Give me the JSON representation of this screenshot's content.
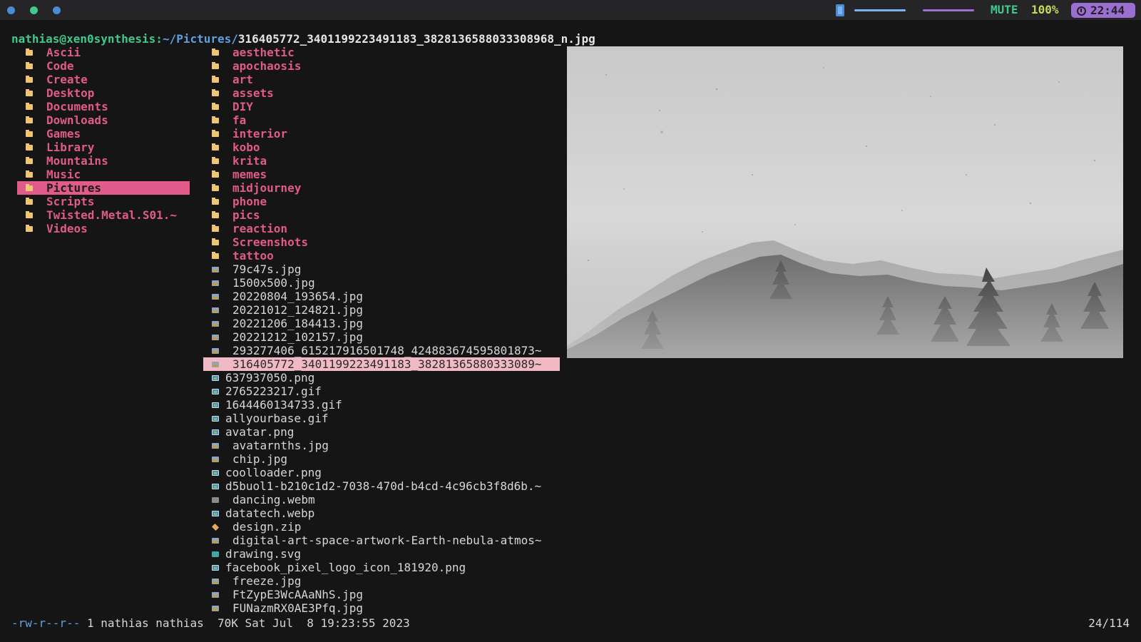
{
  "topbar": {
    "workspaces": [
      {
        "name": "workspace-1",
        "color": "#4a8cd6"
      },
      {
        "name": "workspace-2",
        "color": "#3fc98a"
      },
      {
        "name": "workspace-3",
        "color": "#4a8cd6"
      }
    ],
    "brightness_level": 1.0,
    "volume_level": 1.0,
    "mute_label": "MUTE",
    "battery_label": "100%",
    "clock_label": "22:44",
    "colors": {
      "accent_green": "#3fc98a",
      "accent_purple": "#9b6fcf",
      "accent_blue": "#4a8cd6"
    }
  },
  "path": {
    "host": "nathias@xen0synthesis",
    "separator": ":",
    "dir": "~/Pictures/",
    "file": "316405772_3401199223491183_3828136588033308968_n.jpg"
  },
  "parent_dir": {
    "items": [
      {
        "label": "Ascii",
        "icon": "folder-icon"
      },
      {
        "label": "Code",
        "icon": "folder-icon"
      },
      {
        "label": "Create",
        "icon": "folder-icon"
      },
      {
        "label": "Desktop",
        "icon": "folder-icon"
      },
      {
        "label": "Documents",
        "icon": "folder-icon"
      },
      {
        "label": "Downloads",
        "icon": "folder-icon"
      },
      {
        "label": "Games",
        "icon": "folder-icon"
      },
      {
        "label": "Library",
        "icon": "folder-icon"
      },
      {
        "label": "Mountains",
        "icon": "folder-icon"
      },
      {
        "label": "Music",
        "icon": "folder-icon"
      },
      {
        "label": "Pictures",
        "icon": "folder-icon",
        "selected": true
      },
      {
        "label": "Scripts",
        "icon": "folder-icon"
      },
      {
        "label": "Twisted.Metal.S01.~",
        "icon": "folder-icon"
      },
      {
        "label": "Videos",
        "icon": "folder-icon"
      }
    ]
  },
  "current_dir": {
    "items": [
      {
        "label": "aesthetic",
        "type": "dir"
      },
      {
        "label": "apochaosis",
        "type": "dir"
      },
      {
        "label": "art",
        "type": "dir"
      },
      {
        "label": "assets",
        "type": "dir"
      },
      {
        "label": "DIY",
        "type": "dir"
      },
      {
        "label": "fa",
        "type": "dir"
      },
      {
        "label": "interior",
        "type": "dir"
      },
      {
        "label": "kobo",
        "type": "dir"
      },
      {
        "label": "krita",
        "type": "dir"
      },
      {
        "label": "memes",
        "type": "dir"
      },
      {
        "label": "midjourney",
        "type": "dir"
      },
      {
        "label": "phone",
        "type": "dir"
      },
      {
        "label": "pics",
        "type": "dir"
      },
      {
        "label": "reaction",
        "type": "dir"
      },
      {
        "label": "Screenshots",
        "type": "dir"
      },
      {
        "label": "tattoo",
        "type": "dir"
      },
      {
        "label": "79c47s.jpg",
        "type": "jpg"
      },
      {
        "label": "1500x500.jpg",
        "type": "jpg"
      },
      {
        "label": "20220804_193654.jpg",
        "type": "jpg"
      },
      {
        "label": "20221012_124821.jpg",
        "type": "jpg"
      },
      {
        "label": "20221206_184413.jpg",
        "type": "jpg"
      },
      {
        "label": "20221212_102157.jpg",
        "type": "jpg"
      },
      {
        "label": "293277406_615217916501748_424883674595801873~",
        "type": "jpg"
      },
      {
        "label": "316405772_3401199223491183_38281365880333089~",
        "type": "jpg",
        "selected": true
      },
      {
        "label": "637937050.png",
        "type": "png"
      },
      {
        "label": "2765223217.gif",
        "type": "png"
      },
      {
        "label": "1644460134733.gif",
        "type": "png"
      },
      {
        "label": "allyourbase.gif",
        "type": "png"
      },
      {
        "label": "avatar.png",
        "type": "png"
      },
      {
        "label": "avatarnths.jpg",
        "type": "jpg"
      },
      {
        "label": "chip.jpg",
        "type": "jpg"
      },
      {
        "label": "coolloader.png",
        "type": "png"
      },
      {
        "label": "d5buol1-b210c1d2-7038-470d-b4cd-4c96cb3f8d6b.~",
        "type": "png"
      },
      {
        "label": "dancing.webm",
        "type": "video"
      },
      {
        "label": "datatech.webp",
        "type": "png"
      },
      {
        "label": "design.zip",
        "type": "zip"
      },
      {
        "label": "digital-art-space-artwork-Earth-nebula-atmos~",
        "type": "jpg"
      },
      {
        "label": "drawing.svg",
        "type": "svg"
      },
      {
        "label": "facebook_pixel_logo_icon_181920.png",
        "type": "png"
      },
      {
        "label": "freeze.jpg",
        "type": "jpg"
      },
      {
        "label": "FtZypE3WcAAaNhS.jpg",
        "type": "jpg"
      },
      {
        "label": "FUNazmRX0AE3Pfq.jpg",
        "type": "jpg"
      }
    ]
  },
  "preview": {
    "description_icon": "image-preview"
  },
  "status": {
    "permissions": "-rw-r--r--",
    "details": " 1 nathias nathias  70K Sat Jul  8 19:23:55 2023",
    "position": "24/114"
  }
}
